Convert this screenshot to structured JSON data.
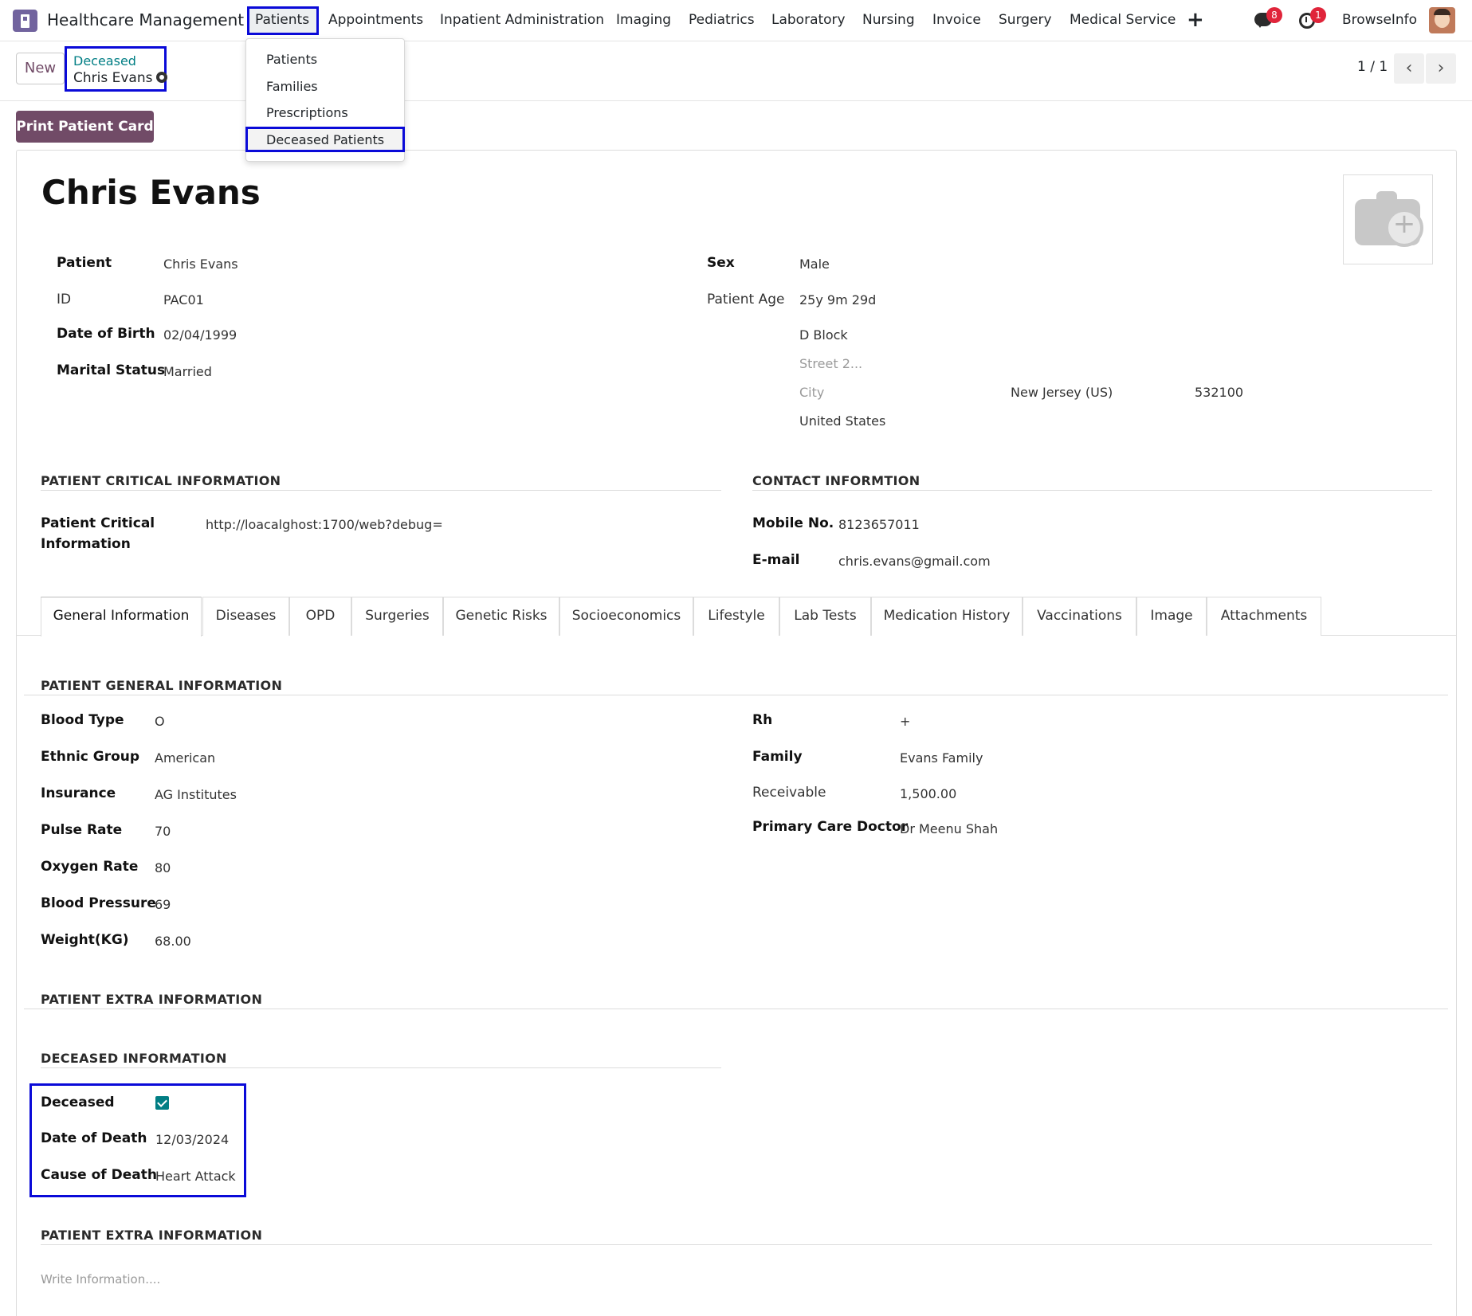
{
  "navbar": {
    "app_name": "Healthcare Management",
    "menus": [
      "Patients",
      "Appointments",
      "Inpatient Administration",
      "Imaging",
      "Pediatrics",
      "Laboratory",
      "Nursing",
      "Invoice",
      "Surgery",
      "Medical Service"
    ],
    "chat_count": "8",
    "activity_count": "1",
    "company": "BrowseInfo",
    "plus_icon": "plus-icon",
    "chat_icon": "chat-icon",
    "activity_icon": "clock-icon"
  },
  "patients_menu": {
    "items": [
      "Patients",
      "Families",
      "Prescriptions",
      "Deceased Patients"
    ],
    "selected": "Deceased Patients"
  },
  "control_panel": {
    "new_label": "New",
    "breadcrumb_parent": "Deceased",
    "breadcrumb_current": "Chris Evans",
    "pager": "1 / 1"
  },
  "actions": {
    "print_label": "Print Patient Card"
  },
  "record": {
    "title": "Chris Evans",
    "left": [
      {
        "label": "Patient",
        "value": "Chris Evans"
      },
      {
        "label": "ID",
        "value": "PAC01"
      },
      {
        "label": "Date of Birth",
        "value": "02/04/1999"
      },
      {
        "label": "Marital Status",
        "value": "Married"
      }
    ],
    "right": [
      {
        "label": "Sex",
        "value": "Male"
      },
      {
        "label": "Patient Age",
        "value": "25y 9m 29d"
      }
    ],
    "address": {
      "street": "D Block",
      "street2_placeholder": "Street 2...",
      "city_placeholder": "City",
      "state": "New Jersey (US)",
      "zip": "532100",
      "country": "United States"
    }
  },
  "critical": {
    "section_title": "PATIENT CRITICAL INFORMATION",
    "label_line1": "Patient Critical",
    "label_line2": "Information",
    "value": "http://loacalghost:1700/web?debug="
  },
  "contact": {
    "section_title": "CONTACT INFORMTION",
    "mobile_label": "Mobile No.",
    "mobile": "8123657011",
    "email_label": "E-mail",
    "email": "chris.evans@gmail.com"
  },
  "tabs": [
    "General Information",
    "Diseases",
    "OPD",
    "Surgeries",
    "Genetic Risks",
    "Socioeconomics",
    "Lifestyle",
    "Lab Tests",
    "Medication History",
    "Vaccinations",
    "Image",
    "Attachments"
  ],
  "active_tab": "General Information",
  "general": {
    "section_title": "PATIENT GENERAL INFORMATION",
    "left": [
      {
        "label": "Blood Type",
        "value": "O"
      },
      {
        "label": "Ethnic Group",
        "value": "American"
      },
      {
        "label": "Insurance",
        "value": "AG Institutes"
      },
      {
        "label": "Pulse Rate",
        "value": "70"
      },
      {
        "label": "Oxygen Rate",
        "value": "80"
      },
      {
        "label": "Blood Pressure",
        "value": "69"
      },
      {
        "label": "Weight(KG)",
        "value": "68.00"
      }
    ],
    "right": [
      {
        "label": "Rh",
        "value": "+"
      },
      {
        "label": "Family",
        "value": "Evans Family"
      },
      {
        "label": "Receivable",
        "value": "1,500.00"
      },
      {
        "label": "Primary Care Doctor",
        "value": "Dr Meenu Shah"
      }
    ]
  },
  "extra_title_1": "PATIENT EXTRA INFORMATION",
  "deceased": {
    "section_title": "DECEASED INFORMATION",
    "deceased_label": "Deceased",
    "deceased_checked": true,
    "date_label": "Date of Death",
    "date": "12/03/2024",
    "cause_label": "Cause of Death",
    "cause": "Heart Attack"
  },
  "extra_title_2": "PATIENT EXTRA INFORMATION",
  "extra_placeholder": "Write Information....",
  "colors": {
    "brand": "#714b67",
    "accent": "#017e84",
    "highlight": "#0a0ad8",
    "badge": "#e0243a"
  }
}
